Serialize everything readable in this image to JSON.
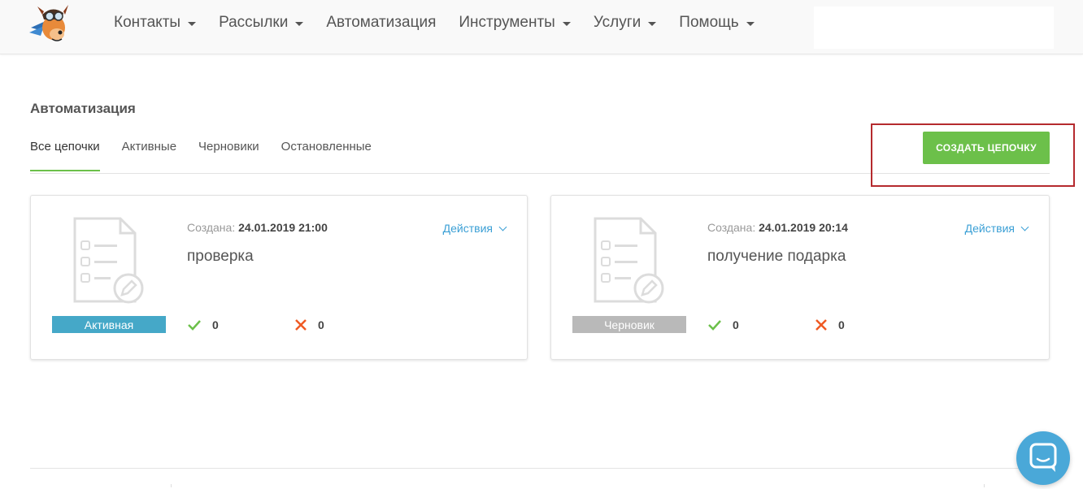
{
  "header": {
    "nav": [
      {
        "label": "Контакты",
        "dropdown": true
      },
      {
        "label": "Рассылки",
        "dropdown": true
      },
      {
        "label": "Автоматизация",
        "dropdown": false
      },
      {
        "label": "Инструменты",
        "dropdown": true
      },
      {
        "label": "Услуги",
        "dropdown": true
      },
      {
        "label": "Помощь",
        "dropdown": true
      }
    ],
    "search_value": ""
  },
  "page": {
    "title": "Автоматизация",
    "tabs": [
      {
        "label": "Все цепочки",
        "active": true
      },
      {
        "label": "Активные",
        "active": false
      },
      {
        "label": "Черновики",
        "active": false
      },
      {
        "label": "Остановленные",
        "active": false
      }
    ],
    "create_button": "СОЗДАТЬ ЦЕПОЧКУ"
  },
  "cards": [
    {
      "created_label": "Создана:",
      "created_date": "24.01.2019 21:00",
      "actions_label": "Действия",
      "name": "проверка",
      "status": "Активная",
      "status_color": "#45a8c8",
      "success_count": "0",
      "fail_count": "0"
    },
    {
      "created_label": "Создана:",
      "created_date": "24.01.2019 20:14",
      "actions_label": "Действия",
      "name": "получение подарка",
      "status": "Черновик",
      "status_color": "#b9b9b9",
      "success_count": "0",
      "fail_count": "0"
    }
  ],
  "colors": {
    "accent_green": "#6cc04a",
    "link_blue": "#3a9fd5",
    "highlight_red": "#b52a2e",
    "success_green": "#6cc04a",
    "fail_orange": "#f05a23",
    "chat_blue": "#4aa8d8"
  },
  "icons": {
    "logo": "dog-pilot-logo",
    "card": "document-checklist-edit-icon",
    "success": "check-icon",
    "fail": "cross-icon",
    "actions": "chevron-down-icon",
    "chat": "chat-icon"
  }
}
